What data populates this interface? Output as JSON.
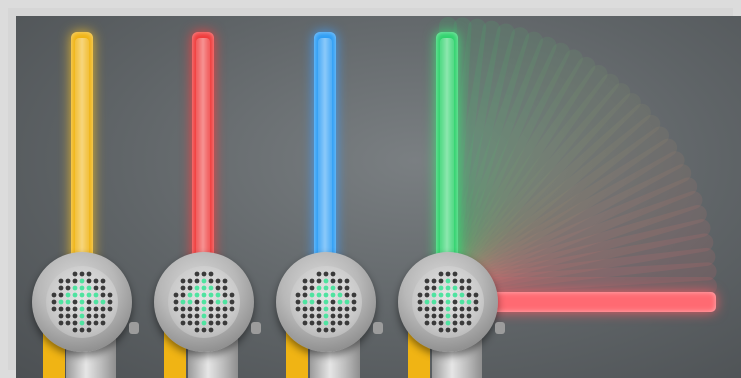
{
  "scene": {
    "description_free": true,
    "controls": [
      {
        "id": "yellow",
        "color": "#f0b414",
        "icon": "arrow-up-dot-icon"
      },
      {
        "id": "red",
        "color": "#ef3a3a",
        "icon": "arrow-up-dot-icon"
      },
      {
        "id": "blue",
        "color": "#2c9df5",
        "icon": "arrow-up-dot-icon"
      },
      {
        "id": "green",
        "color": "#2ed36c",
        "icon": "arrow-up-dot-icon"
      }
    ],
    "sweep": {
      "from_color": "#2ed36c",
      "to_color": "#ff6a72"
    },
    "dot_colors": {
      "active": "#4fe3a0",
      "inactive": "#3a3a3a"
    }
  }
}
